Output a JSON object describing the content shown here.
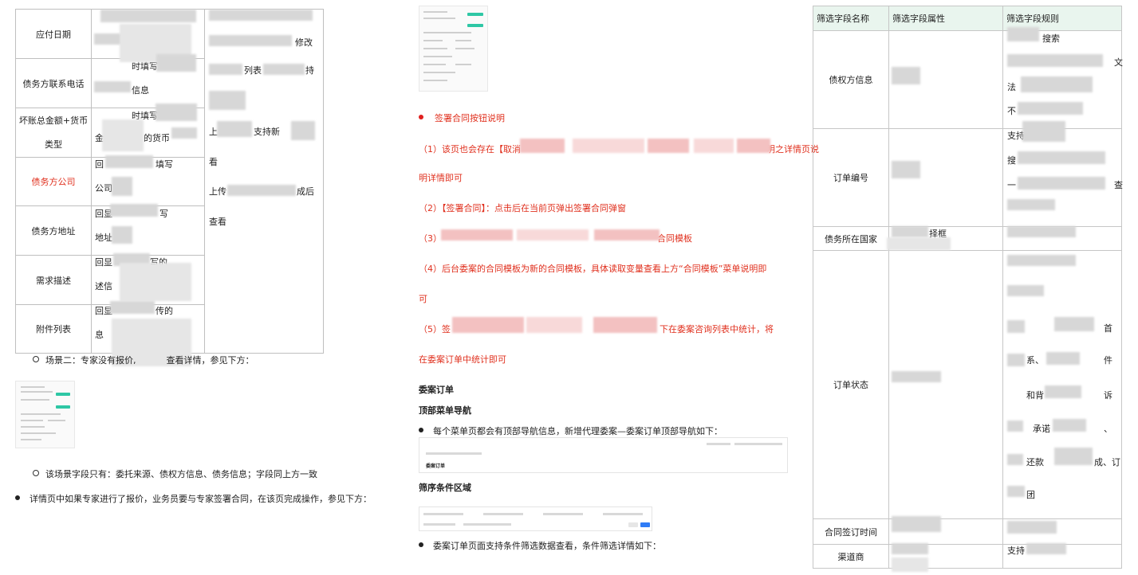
{
  "left": {
    "table_rows": [
      {
        "name": "应付日期",
        "attr": "",
        "rule": "修改",
        "red": false
      },
      {
        "name": "债务方联系电话",
        "attr": "时填写",
        "rule": "列表",
        "red": false
      },
      {
        "name": "坏账总金额+货币类型",
        "attr": "时填写",
        "rule": "支持新",
        "red": false
      },
      {
        "name": "债务方公司",
        "attr": "填写",
        "rule": "看",
        "red": true
      },
      {
        "name": "债务方地址",
        "attr": "写",
        "rule": "上传",
        "red": false
      },
      {
        "name": "需求描述",
        "attr": "写的",
        "rule": "查看",
        "red": false
      },
      {
        "name": "附件列表",
        "attr": "传的",
        "rule": "",
        "red": false
      }
    ],
    "fragments": {
      "r2_extra": "信息",
      "r1_extra": "持",
      "r3_a": "金",
      "r3_b": "的货币",
      "r3_rule_pre": "上",
      "r4_a": "回",
      "r4_b": "公司",
      "r4_rule": "看",
      "r5_a": "回显",
      "r5_b": "地址",
      "r5_rule_a": "上传",
      "r5_rule_b": "成后",
      "r6_a": "回显",
      "r6_b": "述信",
      "r7_a": "回显",
      "r7_b": "息",
      "r2_a": "",
      "r_top_rule": "",
      "r5_rule_c": "查看"
    },
    "scene2": "场景二：专家没有报价,",
    "scene2_tail": "查看详情，参见下方：",
    "scene_fields": "该场景字段只有：委托来源、债权方信息、债务信息；字段同上方一致",
    "detail_bullet": "详情页中如果专家进行了报价，业务员要与专家签署合同，在该页完成操作，参见下方："
  },
  "middle": {
    "sign_title": "签署合同按钮说明",
    "p1_a": "（1）该页也会存在【取消",
    "p1_b": "明之详情页说",
    "p1_c": "明详情即可",
    "p2": "（2）【签署合同】：点击后在当前页弹出签署合同弹窗",
    "p3_a": "（3）",
    "p3_b": "合同模板",
    "p4_a": "（4）后台委案的合同模板为新的合同模板，具体读取变量查看上方“合同模板”菜单说明即",
    "p4_b": "可",
    "p5_a": "（5）签",
    "p5_b": "下在委案咨询列表中统计，将",
    "p5_c": "在委案订单中统计即可",
    "h_order": "委案订单",
    "h_nav": "顶部菜单导航",
    "nav_bullet": "每个菜单页都会有顶部导航信息，新增代理委案—委案订单顶部导航如下：",
    "h_filter": "筛序条件区域",
    "filter_bullet": "委案订单页面支持条件筛选数据查看，条件筛选详情如下：",
    "nav_title": "委案订单"
  },
  "right": {
    "headers": [
      "筛选字段名称",
      "筛选字段属性",
      "筛选字段规则"
    ],
    "rows": [
      {
        "name": "债权方信息",
        "rule_lines": [
          "搜索",
          "文",
          "法",
          "不"
        ]
      },
      {
        "name": "订单编号",
        "rule_lines": [
          "支持",
          "搜",
          "一",
          "查"
        ]
      },
      {
        "name": "债务所在国家",
        "attr": "择框",
        "rule_lines": []
      },
      {
        "name": "订单状态",
        "rule_lines": [
          "首",
          "系、",
          "件",
          "和背",
          "诉",
          "承诺",
          "、",
          "还款",
          "成、订",
          "团"
        ]
      },
      {
        "name": "合同签订时间",
        "rule_lines": []
      },
      {
        "name": "渠道商",
        "rule_lines": [
          "支持"
        ]
      }
    ]
  },
  "colors": {
    "accent_red": "#e0301e",
    "header_green": "#e9f5ee",
    "tag_teal": "#2ec7a5"
  }
}
